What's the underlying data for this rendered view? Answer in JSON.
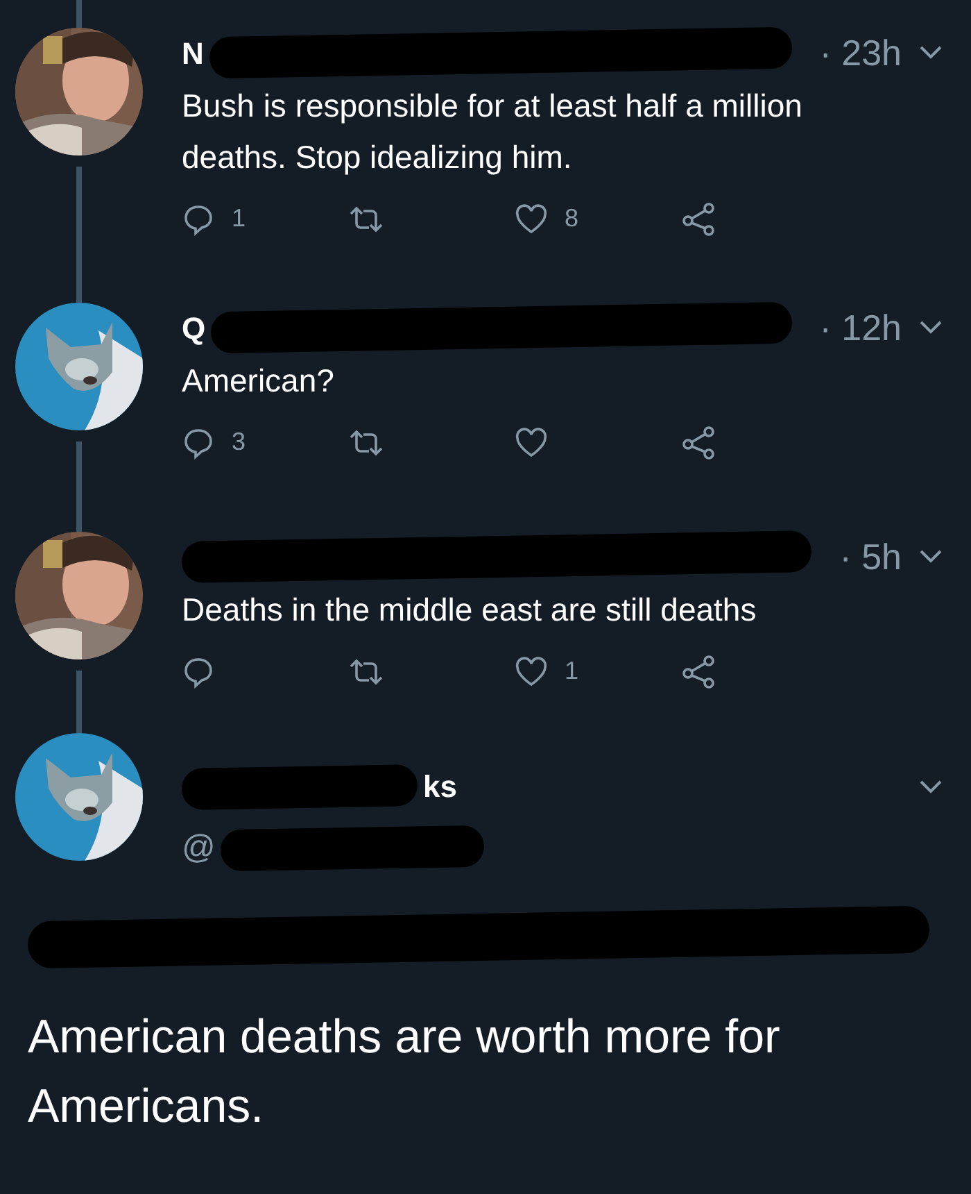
{
  "replies": [
    {
      "name": "N",
      "time": "· 23h",
      "text": "Bush is responsible for at least half a million deaths. Stop idealizing him.",
      "reply_count": "1",
      "like_count": "8"
    },
    {
      "name": "Q",
      "time": "· 12h",
      "text": "American?",
      "reply_count": "3"
    },
    {
      "time": "· 5h",
      "text": "Deaths in the middle east are still deaths",
      "like_count": "1"
    }
  ],
  "main_tweet": {
    "name_end": "ks",
    "handle": "@",
    "text": "American deaths are worth more for Americans."
  }
}
